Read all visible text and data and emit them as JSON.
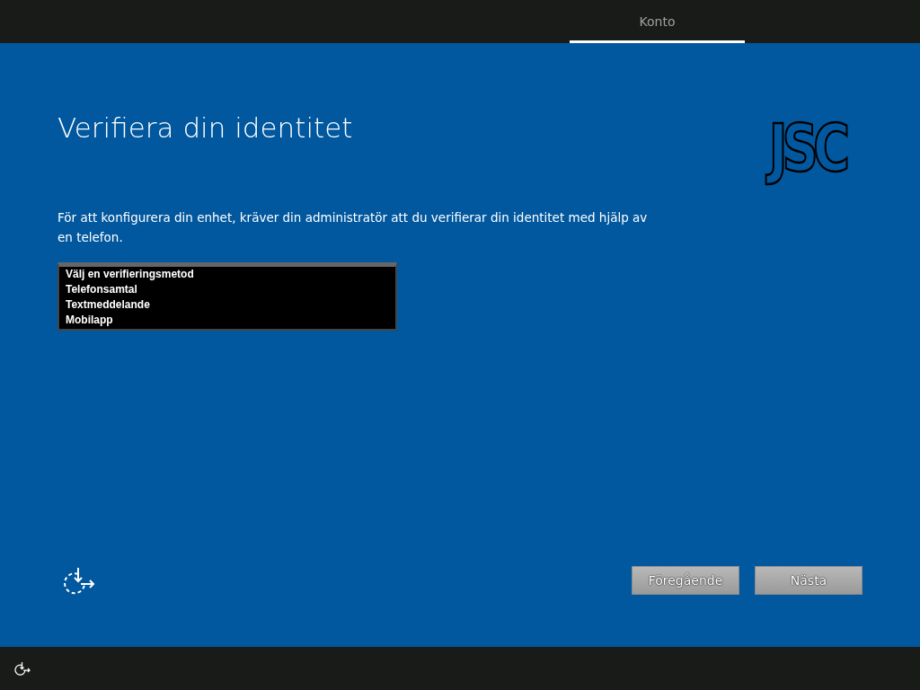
{
  "tabs": [
    {
      "label": "Konto",
      "selected": true
    }
  ],
  "logo": {
    "text": "JSC"
  },
  "title": "Verifiera din identitet",
  "description": "För att konfigurera din enhet, kräver din administratör att du verifierar din identitet med hjälp av en telefon.",
  "listbox": {
    "items": [
      {
        "label": "Välj en verifieringsmetod",
        "selected": false
      },
      {
        "label": "Telefonsamtal",
        "selected": false
      },
      {
        "label": "Textmeddelande",
        "selected": false
      },
      {
        "label": "Mobilapp",
        "selected": false
      }
    ]
  },
  "buttons": [
    {
      "label": "Föregående"
    },
    {
      "label": "Nästa"
    }
  ]
}
